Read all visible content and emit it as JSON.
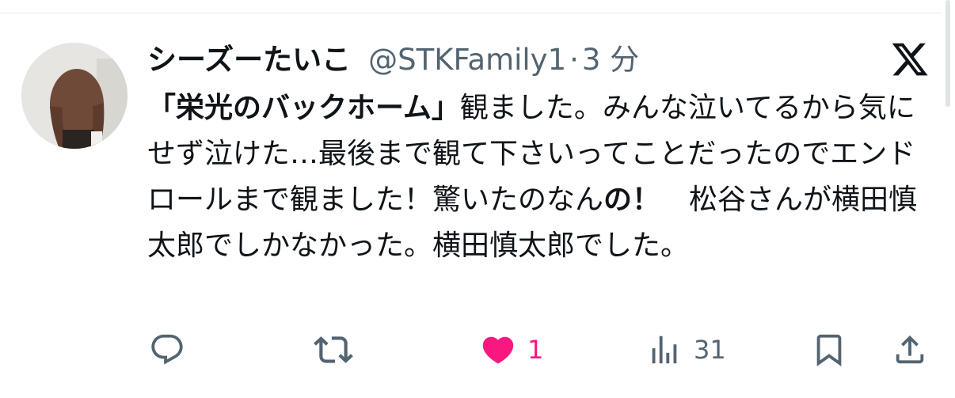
{
  "author": {
    "display_name": "シーズーたいこ",
    "handle": "@STKFamily1",
    "separator": "·",
    "time": "3 分"
  },
  "tweet": {
    "quote_title": "「栄光のバックホーム」",
    "text": "観ました。みんな泣いてるから気にせず泣けた…最後まで観て下さいってことだったのでエンドロールまで観ました！驚いたのなん",
    "bold_text": "の！",
    "text_after": "　松谷さんが横田慎太郎でしかなかった。横田慎太郎でした。"
  },
  "actions": {
    "reply": {
      "icon": "reply-icon"
    },
    "repost": {
      "icon": "repost-icon"
    },
    "like": {
      "icon": "heart-icon",
      "count": "1",
      "liked": true
    },
    "views": {
      "icon": "views-icon",
      "count": "31"
    },
    "bookmark": {
      "icon": "bookmark-icon"
    },
    "share": {
      "icon": "share-icon"
    }
  },
  "colors": {
    "text": "#0f1419",
    "secondary": "#536471",
    "like": "#f91880",
    "divider": "#e6ecef"
  }
}
